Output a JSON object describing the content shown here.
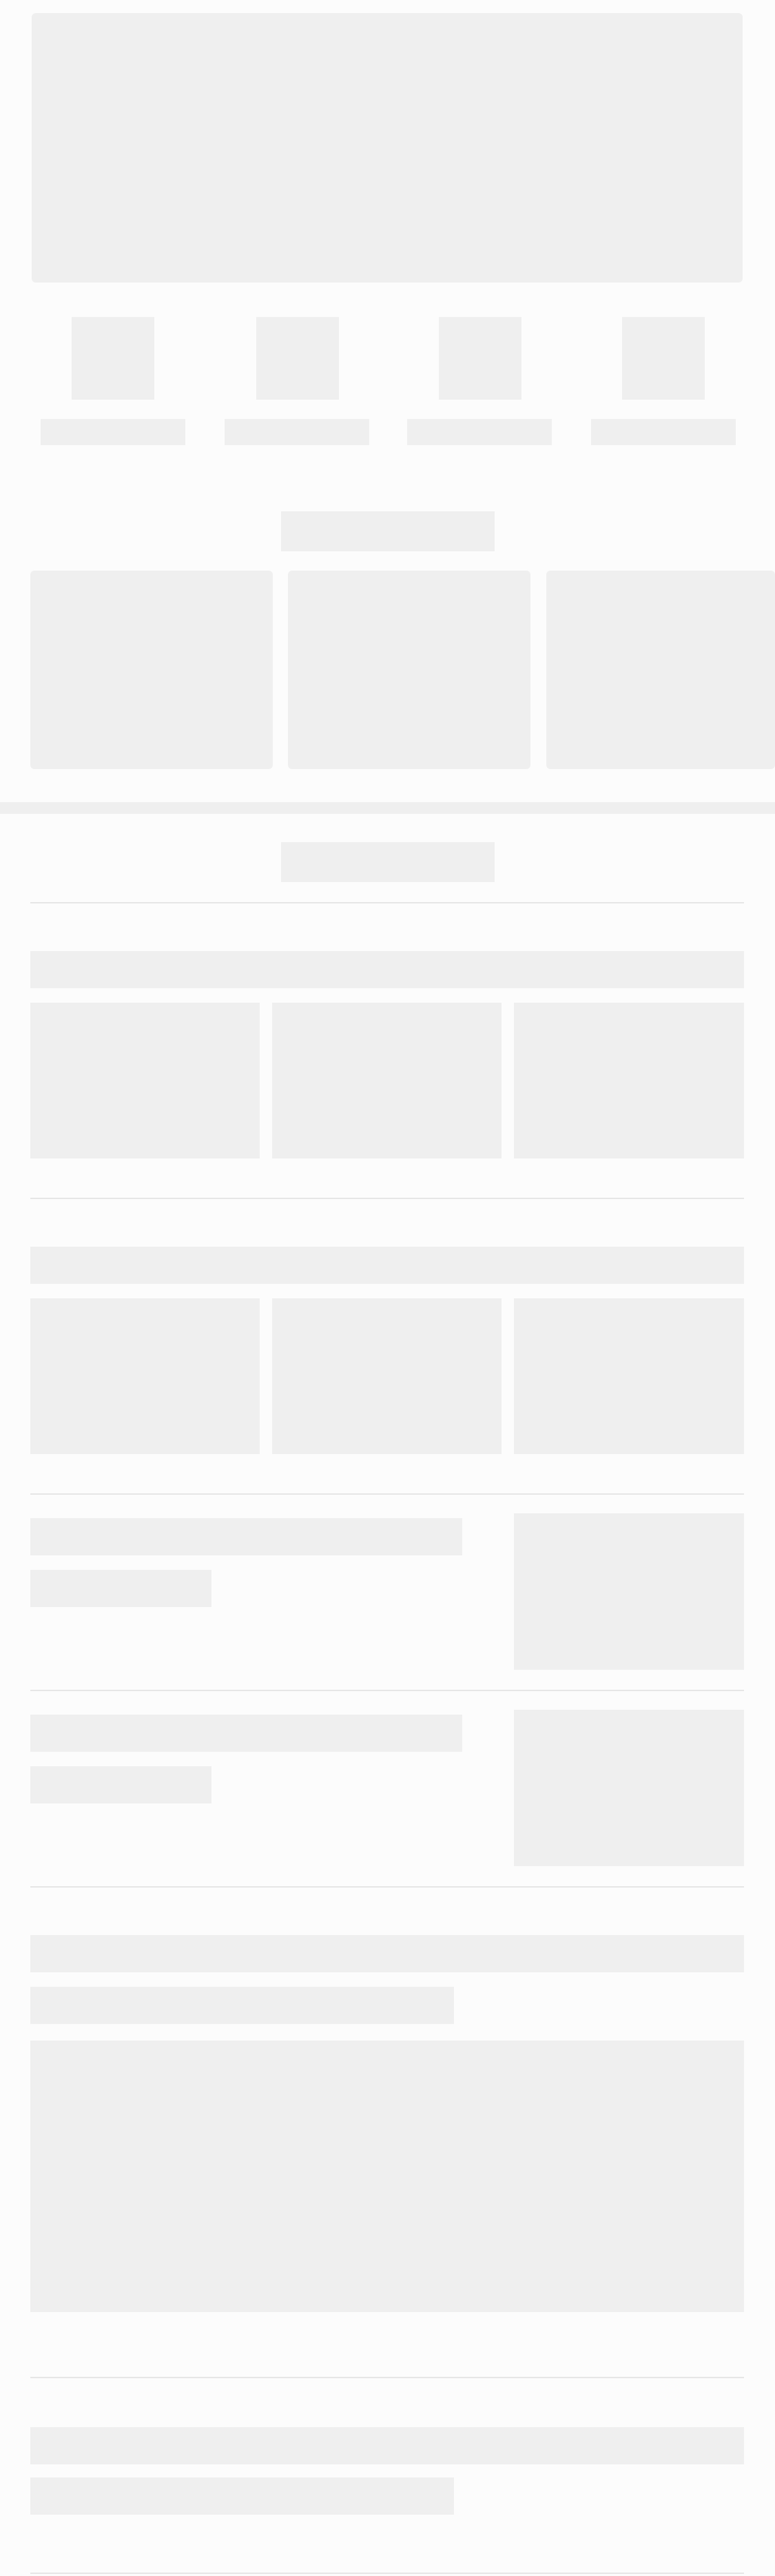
{
  "page": {
    "state": "loading-skeleton",
    "colors": {
      "background": "#fcfcfc",
      "placeholder": "#efefef",
      "divider": "#e6e6e6"
    }
  }
}
